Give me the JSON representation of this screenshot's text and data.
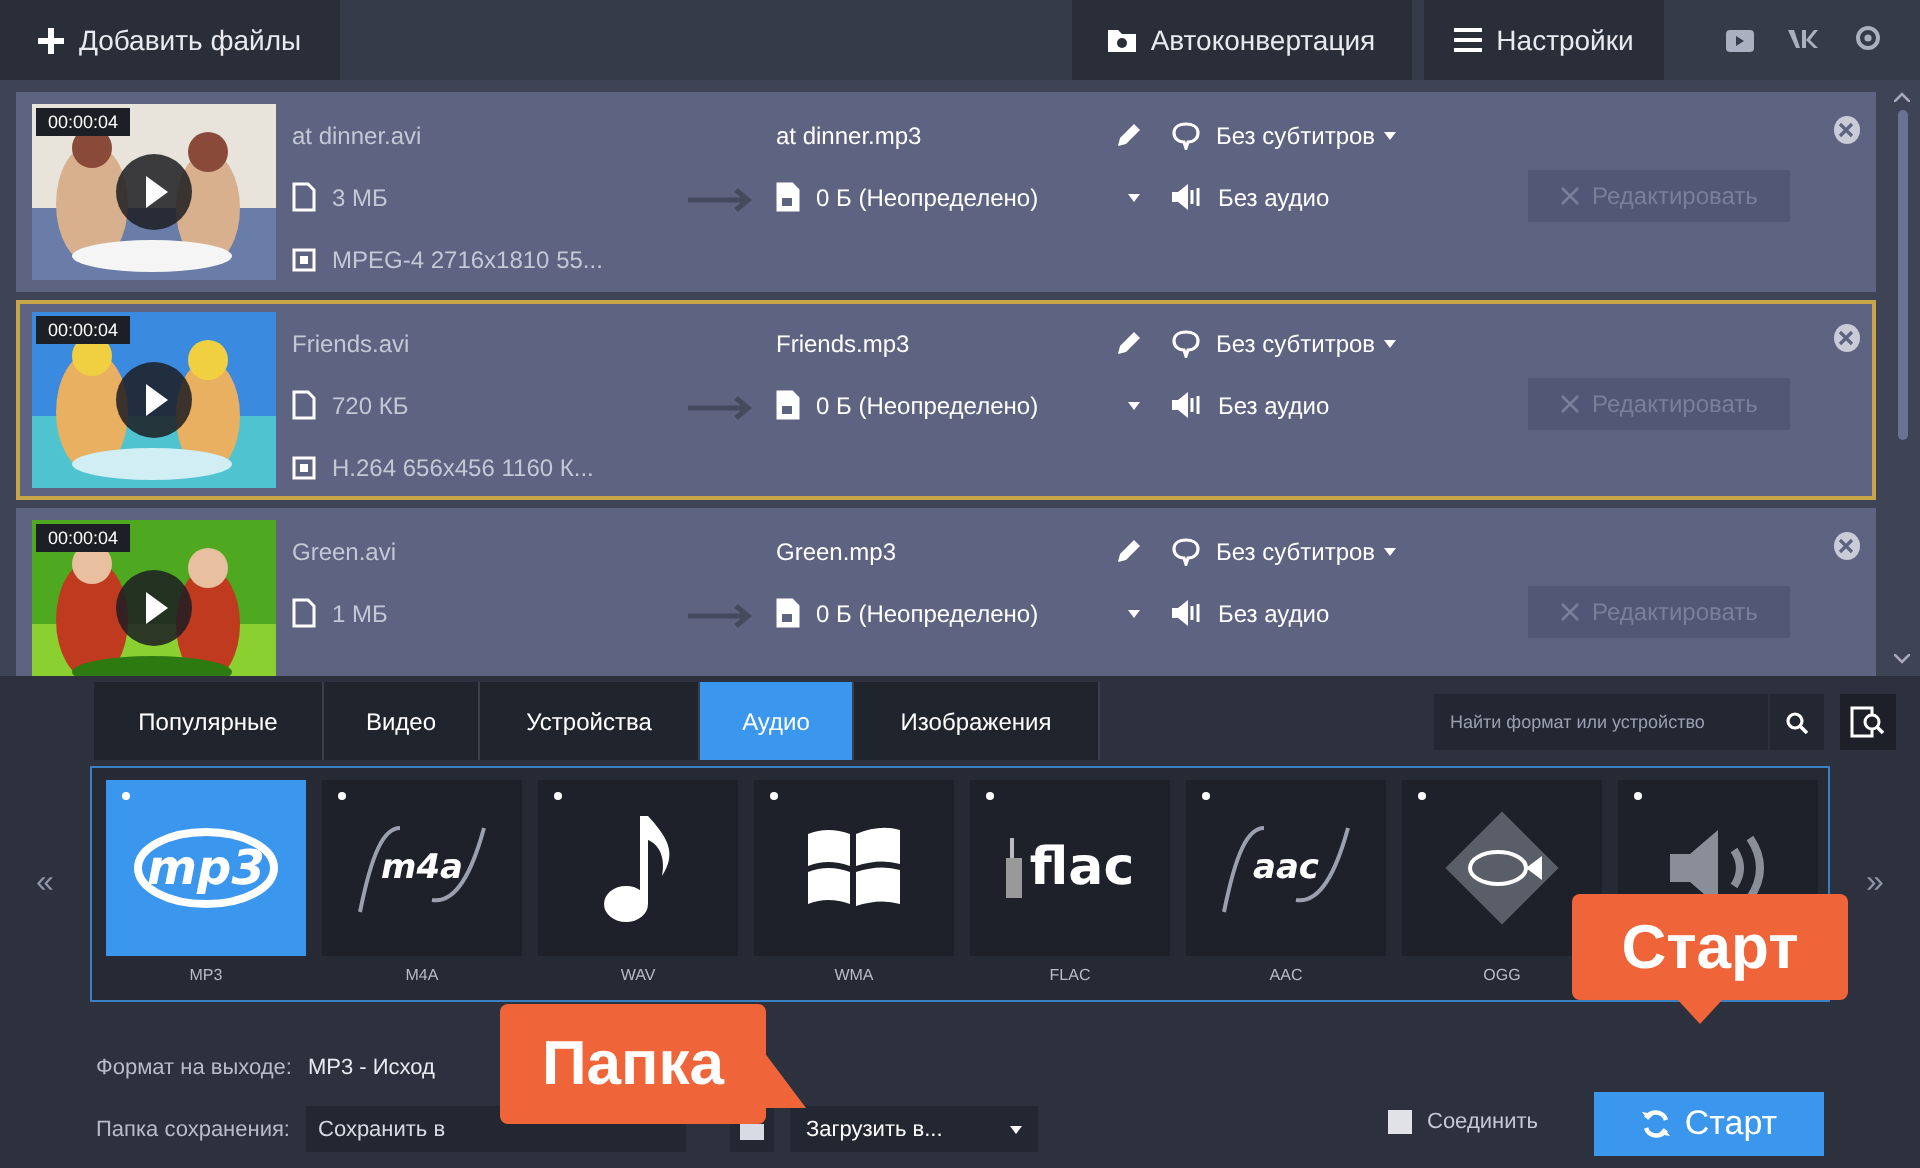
{
  "toolbar": {
    "add_files": "Добавить файлы",
    "autoconvert": "Автоконвертация",
    "settings": "Настройки"
  },
  "files": [
    {
      "selected": false,
      "duration": "00:00:04",
      "name": "at dinner.avi",
      "size": "3 МБ",
      "codec": "MPEG-4 2716x1810 55...",
      "output_name": "at dinner.mp3",
      "output_size": "0 Б (Неопределено)",
      "subtitles": "Без субтитров",
      "audio": "Без аудио",
      "edit": "Редактировать",
      "edit_disabled": true
    },
    {
      "selected": true,
      "duration": "00:00:04",
      "name": "Friends.avi",
      "size": "720 КБ",
      "codec": "H.264 656x456 1160 К...",
      "output_name": "Friends.mp3",
      "output_size": "0 Б (Неопределено)",
      "subtitles": "Без субтитров",
      "audio": "Без аудио",
      "edit": "Редактировать",
      "edit_disabled": true
    },
    {
      "selected": false,
      "duration": "00:00:04",
      "name": "Green.avi",
      "size": "1 МБ",
      "output_name": "Green.mp3",
      "output_size": "0 Б (Неопределено)",
      "subtitles": "Без субтитров",
      "audio": "Без аудио",
      "edit": "Редактировать",
      "edit_disabled": true
    }
  ],
  "format_tabs": [
    {
      "label": "Популярные",
      "selected": false
    },
    {
      "label": "Видео",
      "selected": false
    },
    {
      "label": "Устройства",
      "selected": false
    },
    {
      "label": "Аудио",
      "selected": true
    },
    {
      "label": "Изображения",
      "selected": false
    }
  ],
  "search": {
    "placeholder": "Найти формат или устройство"
  },
  "prev_page": "«",
  "next_page": "»",
  "formats": [
    {
      "kind": "mp3",
      "logo": "mp3",
      "label": "MP3",
      "selected": true
    },
    {
      "kind": "m4a",
      "logo": "m4a",
      "label": "M4A",
      "selected": false
    },
    {
      "kind": "note",
      "label": "WAV",
      "selected": false
    },
    {
      "kind": "windows",
      "label": "WMA",
      "selected": false
    },
    {
      "kind": "flac",
      "logo": "flac",
      "label": "FLAC",
      "selected": false
    },
    {
      "kind": "aac",
      "logo": "aac",
      "label": "AAC",
      "selected": false
    },
    {
      "kind": "ogg",
      "label": "OGG",
      "selected": false
    },
    {
      "kind": "speaker",
      "selected": false
    }
  ],
  "output": {
    "format_label": "Формат на выходе:",
    "format_value": "MP3 - Исход",
    "folder_label": "Папка сохранения:",
    "folder_value": "Сохранить в",
    "upload": "Загрузить в...",
    "merge": {
      "label": "Соединить",
      "checked": false
    },
    "start": "Старт"
  },
  "callouts": [
    {
      "text": "Старт"
    },
    {
      "text": "Папка"
    }
  ]
}
